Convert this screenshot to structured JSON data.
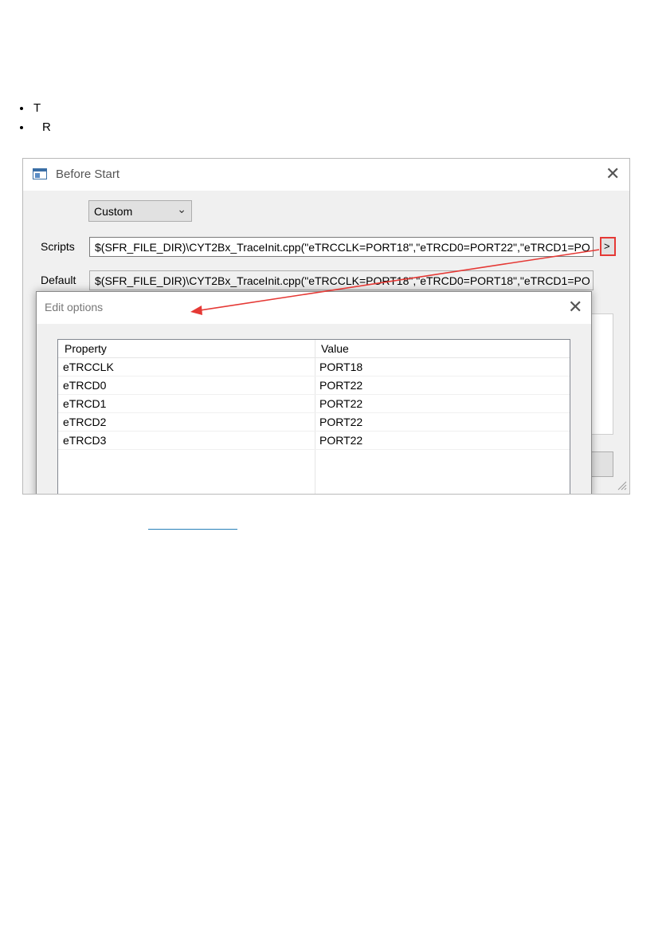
{
  "doc": {
    "bullets": [
      {
        "text": "T"
      },
      {
        "text": "R"
      }
    ],
    "link_text": ""
  },
  "window": {
    "title": "Before Start",
    "icon": "app-window-icon",
    "preset": "Custom",
    "scripts_label": "Scripts",
    "scripts_value": "$(SFR_FILE_DIR)\\CYT2Bx_TraceInit.cpp(\"eTRCCLK=PORT18\",\"eTRCD0=PORT22\",\"eTRCD1=PO",
    "expand_button": ">",
    "default_label": "Default",
    "default_value": "$(SFR_FILE_DIR)\\CYT2Bx_TraceInit.cpp(\"eTRCCLK=PORT18\",\"eTRCD0=PORT18\",\"eTRCD1=PO"
  },
  "dialog": {
    "title": "Edit options",
    "columns": [
      "Property",
      "Value"
    ],
    "rows": [
      {
        "property": "eTRCCLK",
        "value": "PORT18"
      },
      {
        "property": "eTRCD0",
        "value": "PORT22"
      },
      {
        "property": "eTRCD1",
        "value": "PORT22"
      },
      {
        "property": "eTRCD2",
        "value": "PORT22"
      },
      {
        "property": "eTRCD3",
        "value": "PORT22"
      }
    ]
  },
  "colors": {
    "highlight": "#e53935",
    "link": "#2980b9"
  }
}
